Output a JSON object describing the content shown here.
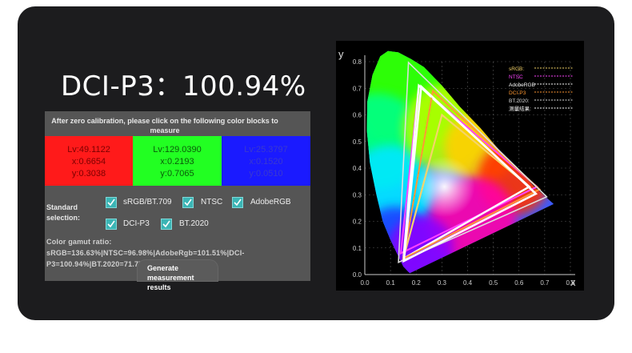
{
  "headline": "DCI-P3：100.94%",
  "panel": {
    "instruction": "After zero calibration, please click on the following color blocks to measure",
    "blocks": [
      {
        "lines": [
          "Lv:49.1122",
          "x:0.6654",
          "y:0.3038"
        ],
        "color": "#ff1a1a"
      },
      {
        "lines": [
          "Lv:129.0390",
          "x:0.2193",
          "y:0.7065"
        ],
        "color": "#22ff22"
      },
      {
        "lines": [
          "Lv:25.3797",
          "x:0.1520",
          "y:0.0510"
        ],
        "color": "#1a1aff"
      }
    ],
    "standard_label": "Standard selection:",
    "standards": [
      {
        "label": "sRGB/BT.709",
        "checked": true
      },
      {
        "label": "NTSC",
        "checked": true
      },
      {
        "label": "AdobeRGB",
        "checked": true
      },
      {
        "label": "DCI-P3",
        "checked": true
      },
      {
        "label": "BT.2020",
        "checked": true
      }
    ],
    "ratio_text": "Color gamut ratio: sRGB=136.63%|NTSC=96.98%|AdobeRgb=101.51%|DCI-P3=100.94%|BT.2020=71.77%",
    "generate_button": "Generate measurement results"
  },
  "chart_data": {
    "type": "scatter",
    "title": "",
    "xlabel": "x",
    "ylabel": "y",
    "xlim": [
      0,
      0.8
    ],
    "ylim": [
      0,
      0.8
    ],
    "x_ticks": [
      "0.0",
      "0.1",
      "0.2",
      "0.3",
      "0.4",
      "0.5",
      "0.6",
      "0.7",
      "0.8"
    ],
    "y_ticks": [
      "0.0",
      "0.1",
      "0.2",
      "0.3",
      "0.4",
      "0.5",
      "0.6",
      "0.7",
      "0.8"
    ],
    "grid": true,
    "legend_position": "top-right",
    "series": [
      {
        "name": "sRGB:",
        "color": "#f5d36a",
        "points": [
          [
            0.64,
            0.33
          ],
          [
            0.3,
            0.6
          ],
          [
            0.15,
            0.06
          ]
        ]
      },
      {
        "name": "NTSC",
        "color": "#ff44ff",
        "points": [
          [
            0.67,
            0.33
          ],
          [
            0.21,
            0.71
          ],
          [
            0.14,
            0.08
          ]
        ]
      },
      {
        "name": "AdobeRGB",
        "color": "#ffffff",
        "points": [
          [
            0.64,
            0.33
          ],
          [
            0.21,
            0.71
          ],
          [
            0.15,
            0.06
          ]
        ]
      },
      {
        "name": "DCI-P3",
        "color": "#ff9933",
        "points": [
          [
            0.68,
            0.32
          ],
          [
            0.265,
            0.69
          ],
          [
            0.15,
            0.06
          ]
        ]
      },
      {
        "name": "BT.2020:",
        "color": "#dddddd",
        "points": [
          [
            0.708,
            0.292
          ],
          [
            0.17,
            0.797
          ],
          [
            0.131,
            0.046
          ]
        ]
      },
      {
        "name": "测量结果:",
        "color": "#ffffff",
        "points": [
          [
            0.6654,
            0.3038
          ],
          [
            0.2193,
            0.7065
          ],
          [
            0.152,
            0.051
          ]
        ]
      }
    ]
  }
}
